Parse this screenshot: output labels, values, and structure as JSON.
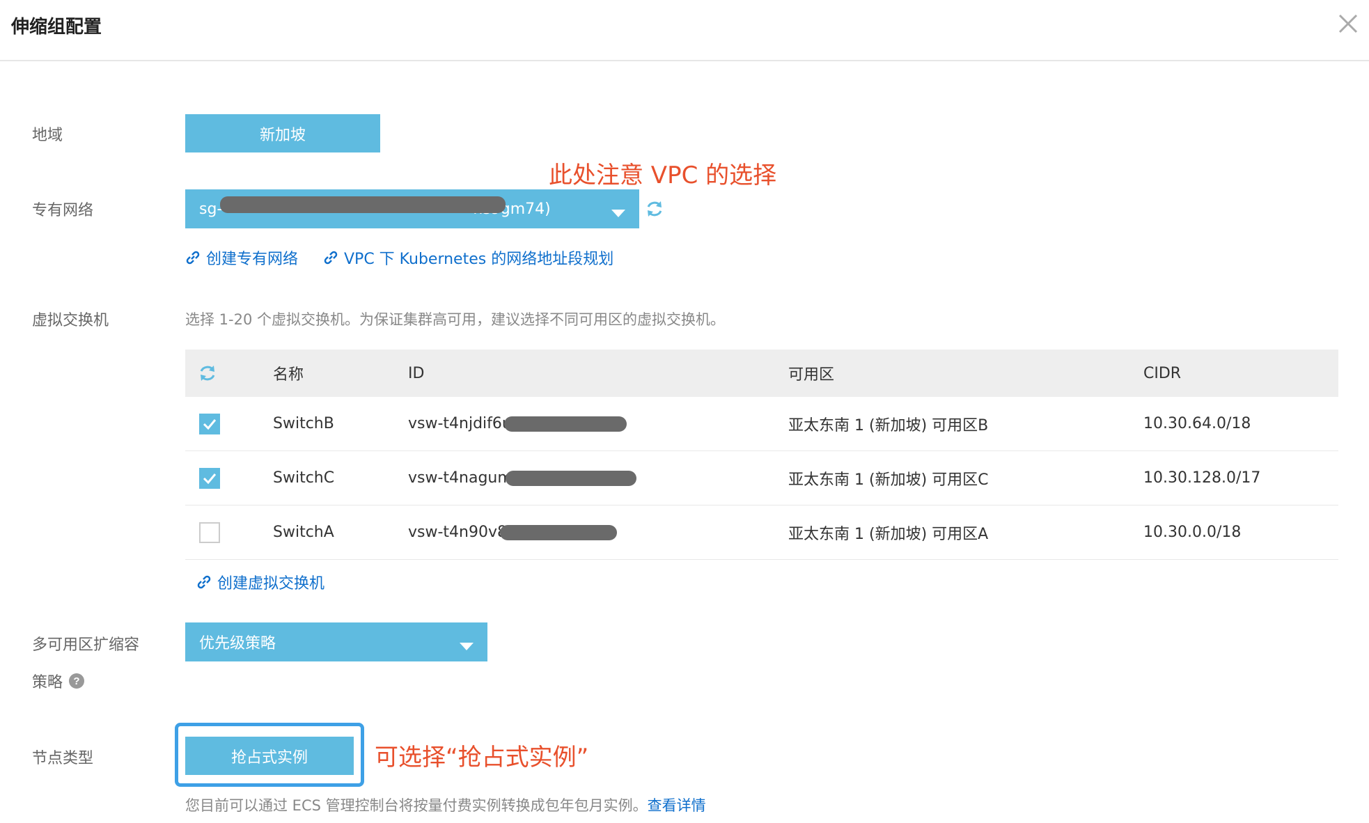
{
  "dialog": {
    "title": "伸缩组配置",
    "close_icon": "close-icon"
  },
  "region": {
    "label": "地域",
    "value": "新加坡"
  },
  "vpc": {
    "label": "专有网络",
    "select_prefix": "sg-",
    "select_suffix": "ns9gm74)",
    "annotation": "此处注意 VPC 的选择",
    "links": [
      "创建专有网络",
      "VPC 下 Kubernetes 的网络地址段规划"
    ]
  },
  "vswitch": {
    "label": "虚拟交换机",
    "hint": "选择 1-20 个虚拟交换机。为保证集群高可用，建议选择不同可用区的虚拟交换机。",
    "columns": [
      "名称",
      "ID",
      "可用区",
      "CIDR"
    ],
    "rows": [
      {
        "checked": true,
        "name": "SwitchB",
        "id": "vsw-t4njdif6u",
        "zone": "亚太东南 1 (新加坡) 可用区B",
        "cidr": "10.30.64.0/18"
      },
      {
        "checked": true,
        "name": "SwitchC",
        "id": "vsw-t4nagum",
        "zone": "亚太东南 1 (新加坡) 可用区C",
        "cidr": "10.30.128.0/17"
      },
      {
        "checked": false,
        "name": "SwitchA",
        "id": "vsw-t4n90v8",
        "zone": "亚太东南 1 (新加坡) 可用区A",
        "cidr": "10.30.0.0/18"
      }
    ],
    "create_link": "创建虚拟交换机"
  },
  "multi_az": {
    "label_line1": "多可用区扩缩容",
    "label_line2": "策略",
    "value": "优先级策略"
  },
  "node_type": {
    "label": "节点类型",
    "button": "抢占式实例",
    "annotation": "可选择“抢占式实例”",
    "note": "您目前可以通过 ECS 管理控制台将按量付费实例转换成包年包月实例。",
    "note_link": "查看详情"
  },
  "colors": {
    "accent": "#5fbbe0",
    "link": "#0f6fcc",
    "annotation": "#e8502c",
    "highlight": "#3ea0e6"
  }
}
